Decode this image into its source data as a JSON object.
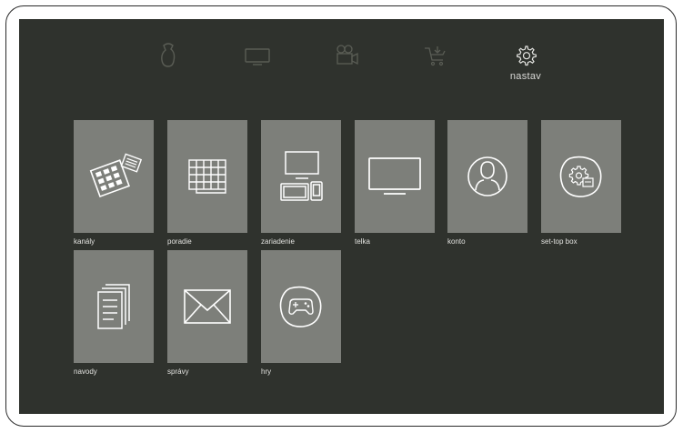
{
  "top_nav": {
    "items": [
      {
        "icon": "hand-icon",
        "label": ""
      },
      {
        "icon": "tv-icon",
        "label": ""
      },
      {
        "icon": "video-camera-icon",
        "label": ""
      },
      {
        "icon": "cart-icon",
        "label": ""
      },
      {
        "icon": "gear-icon",
        "label": "nastav",
        "active": true
      }
    ]
  },
  "tiles": [
    {
      "icon": "channels-remote-icon",
      "label": "kanály"
    },
    {
      "icon": "grid-icon",
      "label": "poradie"
    },
    {
      "icon": "devices-icon",
      "label": "zariadenie"
    },
    {
      "icon": "tv-screen-icon",
      "label": "telka"
    },
    {
      "icon": "user-icon",
      "label": "konto"
    },
    {
      "icon": "settop-gear-icon",
      "label": "set-top box"
    },
    {
      "icon": "documents-icon",
      "label": "navody"
    },
    {
      "icon": "envelope-icon",
      "label": "správy"
    },
    {
      "icon": "gamepad-icon",
      "label": "hry"
    }
  ],
  "colors": {
    "background": "#2f322d",
    "tile": "#7d7f7a",
    "text": "#e2e2df",
    "icon_dim": "#55584f",
    "icon_active": "#e6e6e3"
  }
}
